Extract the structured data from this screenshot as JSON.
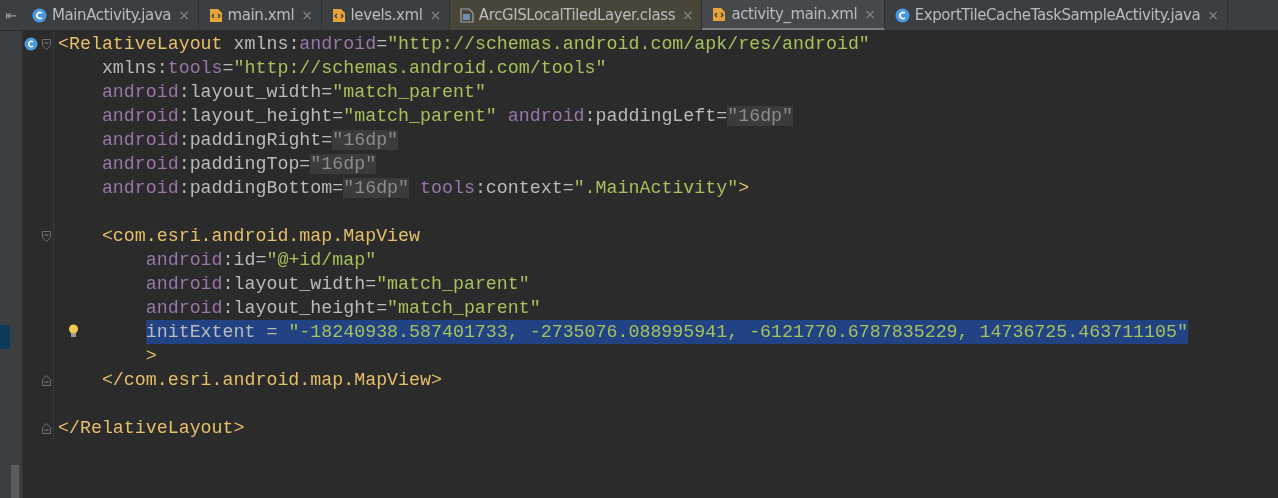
{
  "collapse_glyph": "⇤",
  "tabs": [
    {
      "label": "MainActivity.java",
      "kind": "class",
      "library": false,
      "selected": false
    },
    {
      "label": "main.xml",
      "kind": "xml",
      "library": false,
      "selected": false
    },
    {
      "label": "levels.xml",
      "kind": "xml",
      "library": false,
      "selected": false
    },
    {
      "label": "ArcGISLocalTiledLayer.class",
      "kind": "binary",
      "library": true,
      "selected": false
    },
    {
      "label": "activity_main.xml",
      "kind": "xml",
      "library": false,
      "selected": true
    },
    {
      "label": "ExportTileCacheTaskSampleActivity.java",
      "kind": "class",
      "library": false,
      "selected": false
    }
  ],
  "close_glyph": "×",
  "code": [
    {
      "kind": "class-fold-start",
      "selected": false,
      "tokens": [
        {
          "kind": "tag",
          "text": "<RelativeLayout"
        },
        {
          "kind": "attr",
          "text": " xmlns:"
        },
        {
          "kind": "ns",
          "text": "android"
        },
        {
          "kind": "attr",
          "text": "="
        },
        {
          "kind": "string",
          "text": "\"http://schemas.android.com/apk/res/android\""
        }
      ],
      "children": [
        {
          "kind": "plain",
          "selected": false,
          "tokens": [
            {
              "kind": "attr",
              "text": "xmlns:"
            },
            {
              "kind": "ns",
              "text": "tools"
            },
            {
              "kind": "attr",
              "text": "="
            },
            {
              "kind": "string",
              "text": "\"http://schemas.android.com/tools\""
            }
          ]
        },
        {
          "kind": "plain",
          "selected": false,
          "tokens": [
            {
              "kind": "ns",
              "text": "android"
            },
            {
              "kind": "attr",
              "text": ":layout_width="
            },
            {
              "kind": "string",
              "text": "\"match_parent\""
            }
          ]
        },
        {
          "kind": "plain",
          "selected": false,
          "tokens": [
            {
              "kind": "ns",
              "text": "android"
            },
            {
              "kind": "attr",
              "text": ":layout_height="
            },
            {
              "kind": "string",
              "text": "\"match_parent\" "
            },
            {
              "kind": "ns",
              "text": "android"
            },
            {
              "kind": "attr",
              "text": ":paddingLeft="
            },
            {
              "kind": "folded",
              "text": "\"16dp\""
            }
          ]
        },
        {
          "kind": "plain",
          "selected": false,
          "tokens": [
            {
              "kind": "ns",
              "text": "android"
            },
            {
              "kind": "attr",
              "text": ":paddingRight="
            },
            {
              "kind": "folded",
              "text": "\"16dp\""
            }
          ]
        },
        {
          "kind": "plain",
          "selected": false,
          "tokens": [
            {
              "kind": "ns",
              "text": "android"
            },
            {
              "kind": "attr",
              "text": ":paddingTop="
            },
            {
              "kind": "folded",
              "text": "\"16dp\""
            }
          ]
        },
        {
          "kind": "plain",
          "selected": false,
          "tokens": [
            {
              "kind": "ns",
              "text": "android"
            },
            {
              "kind": "attr",
              "text": ":paddingBottom="
            },
            {
              "kind": "folded",
              "text": "\"16dp\""
            },
            {
              "kind": "ns",
              "text": " tools"
            },
            {
              "kind": "attr",
              "text": ":context="
            },
            {
              "kind": "string",
              "text": "\".MainActivity\""
            },
            {
              "kind": "tag",
              "text": ">"
            }
          ]
        },
        {
          "kind": "plain",
          "selected": false
        },
        {
          "kind": "fold-start",
          "selected": false,
          "tokens": [
            {
              "kind": "tag",
              "text": "<com.esri.android.map.MapView"
            }
          ],
          "children": [
            {
              "kind": "plain",
              "selected": false,
              "tokens": [
                {
                  "kind": "ns",
                  "text": "android"
                },
                {
                  "kind": "attr",
                  "text": ":id="
                },
                {
                  "kind": "string",
                  "text": "\"@+id/map\""
                }
              ]
            },
            {
              "kind": "plain",
              "selected": false,
              "tokens": [
                {
                  "kind": "ns",
                  "text": "android"
                },
                {
                  "kind": "attr",
                  "text": ":layout_width="
                },
                {
                  "kind": "string",
                  "text": "\"match_parent\""
                }
              ]
            },
            {
              "kind": "plain",
              "selected": false,
              "tokens": [
                {
                  "kind": "ns",
                  "text": "android"
                },
                {
                  "kind": "attr",
                  "text": ":layout_height="
                },
                {
                  "kind": "string",
                  "text": "\"match_parent\""
                }
              ]
            },
            {
              "kind": "bulb",
              "selected": true,
              "tokens": [
                {
                  "kind": "attr",
                  "text": "initExtent = "
                },
                {
                  "kind": "string",
                  "text": "\"-18240938.587401733, -2735076.088995941, -6121770.6787835229, 14736725.463711105\""
                }
              ]
            },
            {
              "kind": "plain",
              "selected": false,
              "tokens": [
                {
                  "kind": "tag",
                  "text": ">"
                }
              ]
            }
          ]
        },
        {
          "kind": "fold-end",
          "selected": false,
          "tokens": [
            {
              "kind": "tag",
              "text": "</com.esri.android.map.MapView>"
            }
          ]
        },
        {
          "kind": "plain",
          "selected": false
        }
      ]
    },
    {
      "kind": "fold-end",
      "selected": false,
      "tokens": [
        {
          "kind": "tag",
          "text": "</RelativeLayout>"
        }
      ]
    }
  ]
}
